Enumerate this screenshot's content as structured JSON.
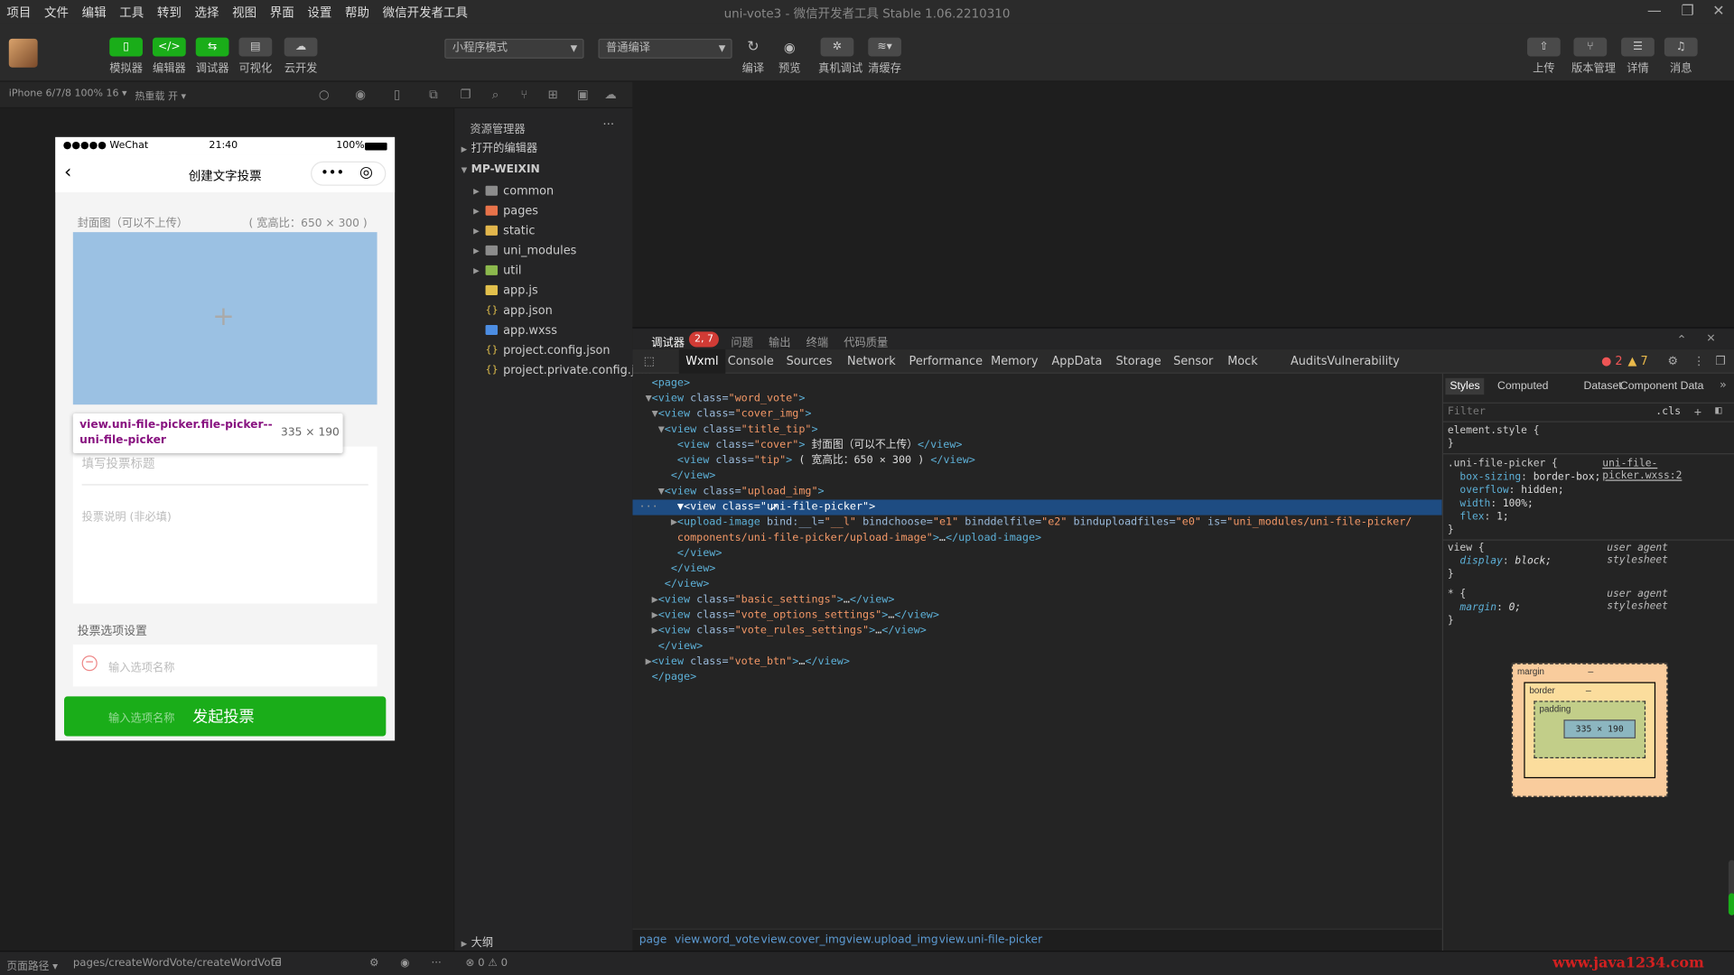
{
  "menubar": {
    "items": [
      "项目",
      "文件",
      "编辑",
      "工具",
      "转到",
      "选择",
      "视图",
      "界面",
      "设置",
      "帮助",
      "微信开发者工具"
    ],
    "window_title": "uni-vote3 - 微信开发者工具 Stable 1.06.2210310"
  },
  "toolbar": {
    "buttons": [
      {
        "label": "模拟器",
        "icon": "phone-icon"
      },
      {
        "label": "编辑器",
        "icon": "code-icon"
      },
      {
        "label": "调试器",
        "icon": "debug-icon"
      },
      {
        "label": "可视化",
        "icon": "visual-icon"
      },
      {
        "label": "云开发",
        "icon": "cloud-icon"
      }
    ],
    "mode_select": "小程序模式",
    "compile_select": "普通编译",
    "actions": [
      {
        "label": "编译",
        "icon": "refresh-icon"
      },
      {
        "label": "预览",
        "icon": "eye-icon"
      },
      {
        "label": "真机调试",
        "icon": "bug-icon"
      },
      {
        "label": "清缓存",
        "icon": "layers-icon"
      }
    ],
    "right_actions": [
      {
        "label": "上传",
        "icon": "upload-icon"
      },
      {
        "label": "版本管理",
        "icon": "branch-icon"
      },
      {
        "label": "详情",
        "icon": "menu-icon"
      },
      {
        "label": "消息",
        "icon": "bell-icon"
      }
    ]
  },
  "simulator": {
    "device": "iPhone 6/7/8 100% 16 ▾",
    "hot_reload": "热重载 开 ▾",
    "status_carrier": "●●●●● WeChat",
    "status_time": "21:40",
    "status_battery": "100%",
    "page_title": "创建文字投票",
    "cover_label": "封面图（可以不上传）",
    "cover_ratio": "( 宽高比：650 × 300 )",
    "plus": "+",
    "tooltip_selector": "view.uni-file-picker.file-picker--",
    "tooltip_selector2": "uni-file-picker",
    "tooltip_size": "335 × 190",
    "title_placeholder": "填写投票标题",
    "desc_placeholder": "投票说明 (非必填)",
    "options_heading": "投票选项设置",
    "option_placeholder": "输入选项名称",
    "submit_ghost": "输入选项名称",
    "submit_label": "发起投票"
  },
  "explorer": {
    "title": "资源管理器",
    "more": "···",
    "open_editors": "打开的编辑器",
    "root": "MP-WEIXIN",
    "items": [
      {
        "name": "common",
        "type": "folder",
        "color": "#8c8c8c"
      },
      {
        "name": "pages",
        "type": "folder",
        "color": "#e8734a"
      },
      {
        "name": "static",
        "type": "folder",
        "color": "#e2b64c"
      },
      {
        "name": "uni_modules",
        "type": "folder",
        "color": "#8c8c8c"
      },
      {
        "name": "util",
        "type": "folder",
        "color": "#8cb94d"
      },
      {
        "name": "app.js",
        "type": "js",
        "color": "#e2c04c"
      },
      {
        "name": "app.json",
        "type": "json",
        "color": "#e2c04c"
      },
      {
        "name": "app.wxss",
        "type": "wxss",
        "color": "#4c8de2"
      },
      {
        "name": "project.config.json",
        "type": "json",
        "color": "#e2c04c"
      },
      {
        "name": "project.private.config.js...",
        "type": "json",
        "color": "#e2c04c"
      }
    ],
    "outline": "大纲"
  },
  "devtools": {
    "top_tabs": [
      "调试器",
      "问题",
      "输出",
      "终端",
      "代码质量"
    ],
    "badge": "2, 7",
    "tabs": [
      "Wxml",
      "Console",
      "Sources",
      "Network",
      "Performance",
      "Memory",
      "AppData",
      "Storage",
      "Sensor",
      "Mock",
      "Audits",
      "Vulnerability"
    ],
    "errors": "2",
    "warnings": "7",
    "breadcrumbs": [
      "page",
      "view.word_vote",
      "view.cover_img",
      "view.upload_img",
      "view.uni-file-picker"
    ],
    "styles_tabs": [
      "Styles",
      "Computed",
      "Dataset",
      "Component Data"
    ],
    "filter_placeholder": "Filter",
    "cls": ".cls",
    "box_margin": "margin",
    "box_border": "border",
    "box_padding": "padding",
    "box_dash": "–",
    "box_size": "335 × 190"
  },
  "statusbar": {
    "path_label": "页面路径 ▾",
    "path": "pages/createWordVote/createWordVote",
    "counts": "⊗ 0 ⚠ 0",
    "watermark": "www.java1234.com"
  }
}
